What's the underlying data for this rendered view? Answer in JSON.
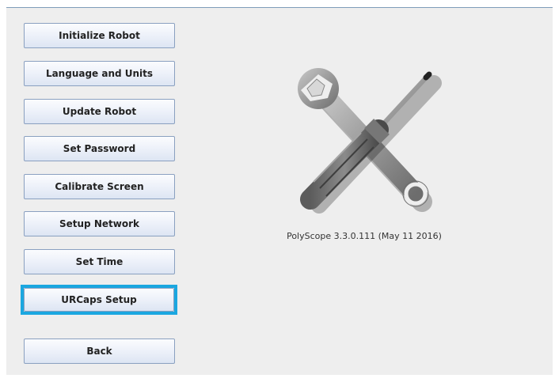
{
  "menu": {
    "initialize_robot": "Initialize Robot",
    "language_and_units": "Language and Units",
    "update_robot": "Update Robot",
    "set_password": "Set Password",
    "calibrate_screen": "Calibrate Screen",
    "setup_network": "Setup Network",
    "set_time": "Set Time",
    "urcaps_setup": "URCaps Setup",
    "back": "Back"
  },
  "version_text": "PolyScope 3.3.0.111 (May 11 2016)",
  "icons": {
    "tools": "wrench-and-screwdriver-icon"
  },
  "colors": {
    "focus": "#1ba7e0",
    "panel": "#eeeeee",
    "button_border": "#8aa0c0"
  }
}
